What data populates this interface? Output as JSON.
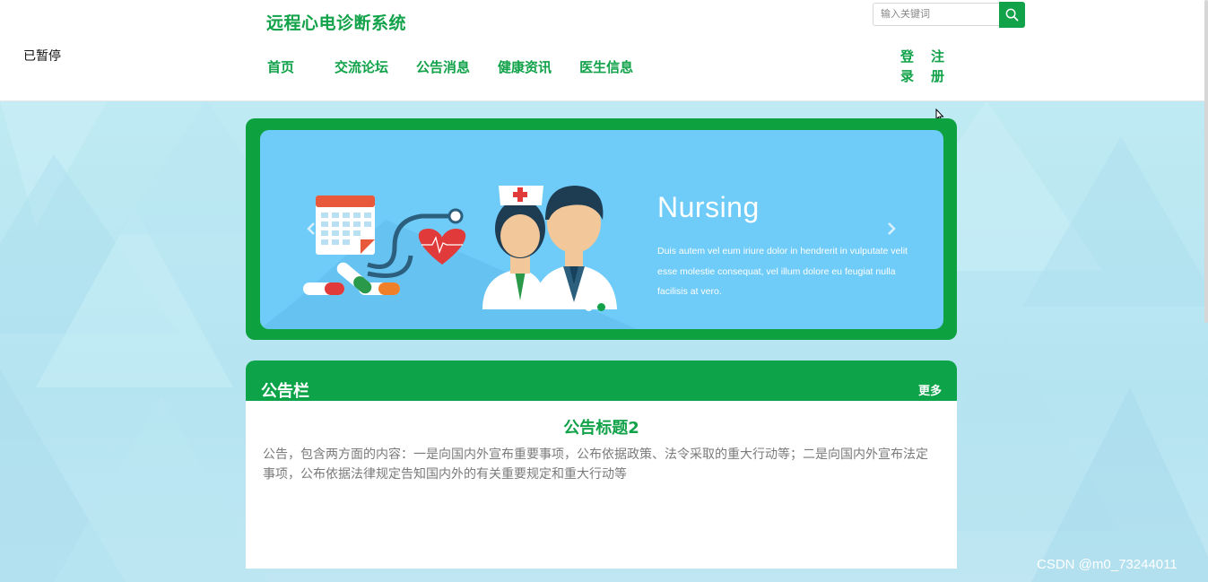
{
  "overlay": {
    "paused_text": "已暂停"
  },
  "header": {
    "site_title": "远程心电诊断系统",
    "nav": [
      "首页",
      "交流论坛",
      "公告消息",
      "健康资讯",
      "医生信息"
    ],
    "search_placeholder": "输入关键词",
    "login_chars": [
      "登",
      "录"
    ],
    "register_chars": [
      "注",
      "册"
    ]
  },
  "banner": {
    "title": "Nursing",
    "text": "Duis autem vel eum iriure dolor in hendrerit in vulputate velit esse molestie consequat, vel illum dolore eu feugiat nulla facilisis at vero.",
    "slide_count": 2,
    "active_slide": 2
  },
  "notice": {
    "heading": "公告栏",
    "more": "更多",
    "title": "公告标题2",
    "body": "公告，包含两方面的内容：一是向国内外宣布重要事项，公布依据政策、法令采取的重大行动等；二是向国内外宣布法定事项，公布依据法律规定告知国内外的有关重要规定和重大行动等"
  },
  "watermark": "CSDN @m0_73244011",
  "colors": {
    "brand_green": "#11a24a",
    "banner_blue": "#6fcbf7",
    "page_bg": "#c3ecf3"
  },
  "icons": [
    "search-icon",
    "chevron-left-icon",
    "chevron-right-icon",
    "mouse-cursor-icon"
  ]
}
